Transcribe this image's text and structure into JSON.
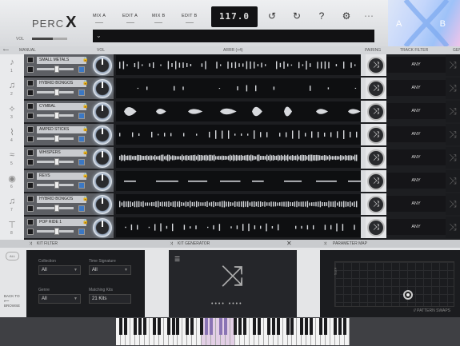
{
  "app": {
    "logo_prefix": "PERC",
    "logo_suffix": "X",
    "vol_label": "VOL"
  },
  "toolbar": {
    "tabs": [
      "MIX A",
      "EDIT A",
      "MIX B",
      "EDIT B"
    ],
    "tempo": "117.0",
    "preset_chevron": "⌄",
    "icons": [
      "undo-icon",
      "redo-icon",
      "help-icon",
      "gear-icon",
      "more-icon"
    ]
  },
  "ab": {
    "a": "A",
    "b": "B"
  },
  "subheader": {
    "manual": "MANUAL",
    "vol": "VOL",
    "arrr": "ARRR (+4)",
    "pairing": "PAIRING",
    "track_filter": "TRACK FILTER",
    "gen": "GEN"
  },
  "lanes": [
    {
      "name": "SMALL METALS",
      "num": "1",
      "filter": "ANY"
    },
    {
      "name": "HYBRID BONGOS",
      "num": "2",
      "filter": "ANY"
    },
    {
      "name": "CYMBAL",
      "num": "3",
      "filter": "ANY"
    },
    {
      "name": "AMPED STICKS",
      "num": "4",
      "filter": "ANY"
    },
    {
      "name": "WHISPERS",
      "num": "5",
      "filter": "ANY"
    },
    {
      "name": "REVS",
      "num": "6",
      "filter": "ANY"
    },
    {
      "name": "HYBRID BONGOS",
      "num": "7",
      "filter": "ANY"
    },
    {
      "name": "POP RIDE 1",
      "num": "8",
      "filter": "ANY"
    }
  ],
  "bottom": {
    "kit_filter": "KIT FILTER",
    "kit_generator": "KIT GENERATOR",
    "parameter_map": "PARAMETER MAP",
    "all": "ALL",
    "back": "BACK TO",
    "browse": "BROWSE",
    "fields": [
      {
        "label": "Collection",
        "value": "All"
      },
      {
        "label": "Time Signature",
        "value": "All"
      },
      {
        "label": "Genre",
        "value": "All"
      },
      {
        "label": "Matching Kits",
        "value": "21 Kits"
      }
    ],
    "kit_axis": "KITS",
    "pattern_swaps": "// PATTERN SWAPS",
    "dots": "••••  ••••"
  }
}
